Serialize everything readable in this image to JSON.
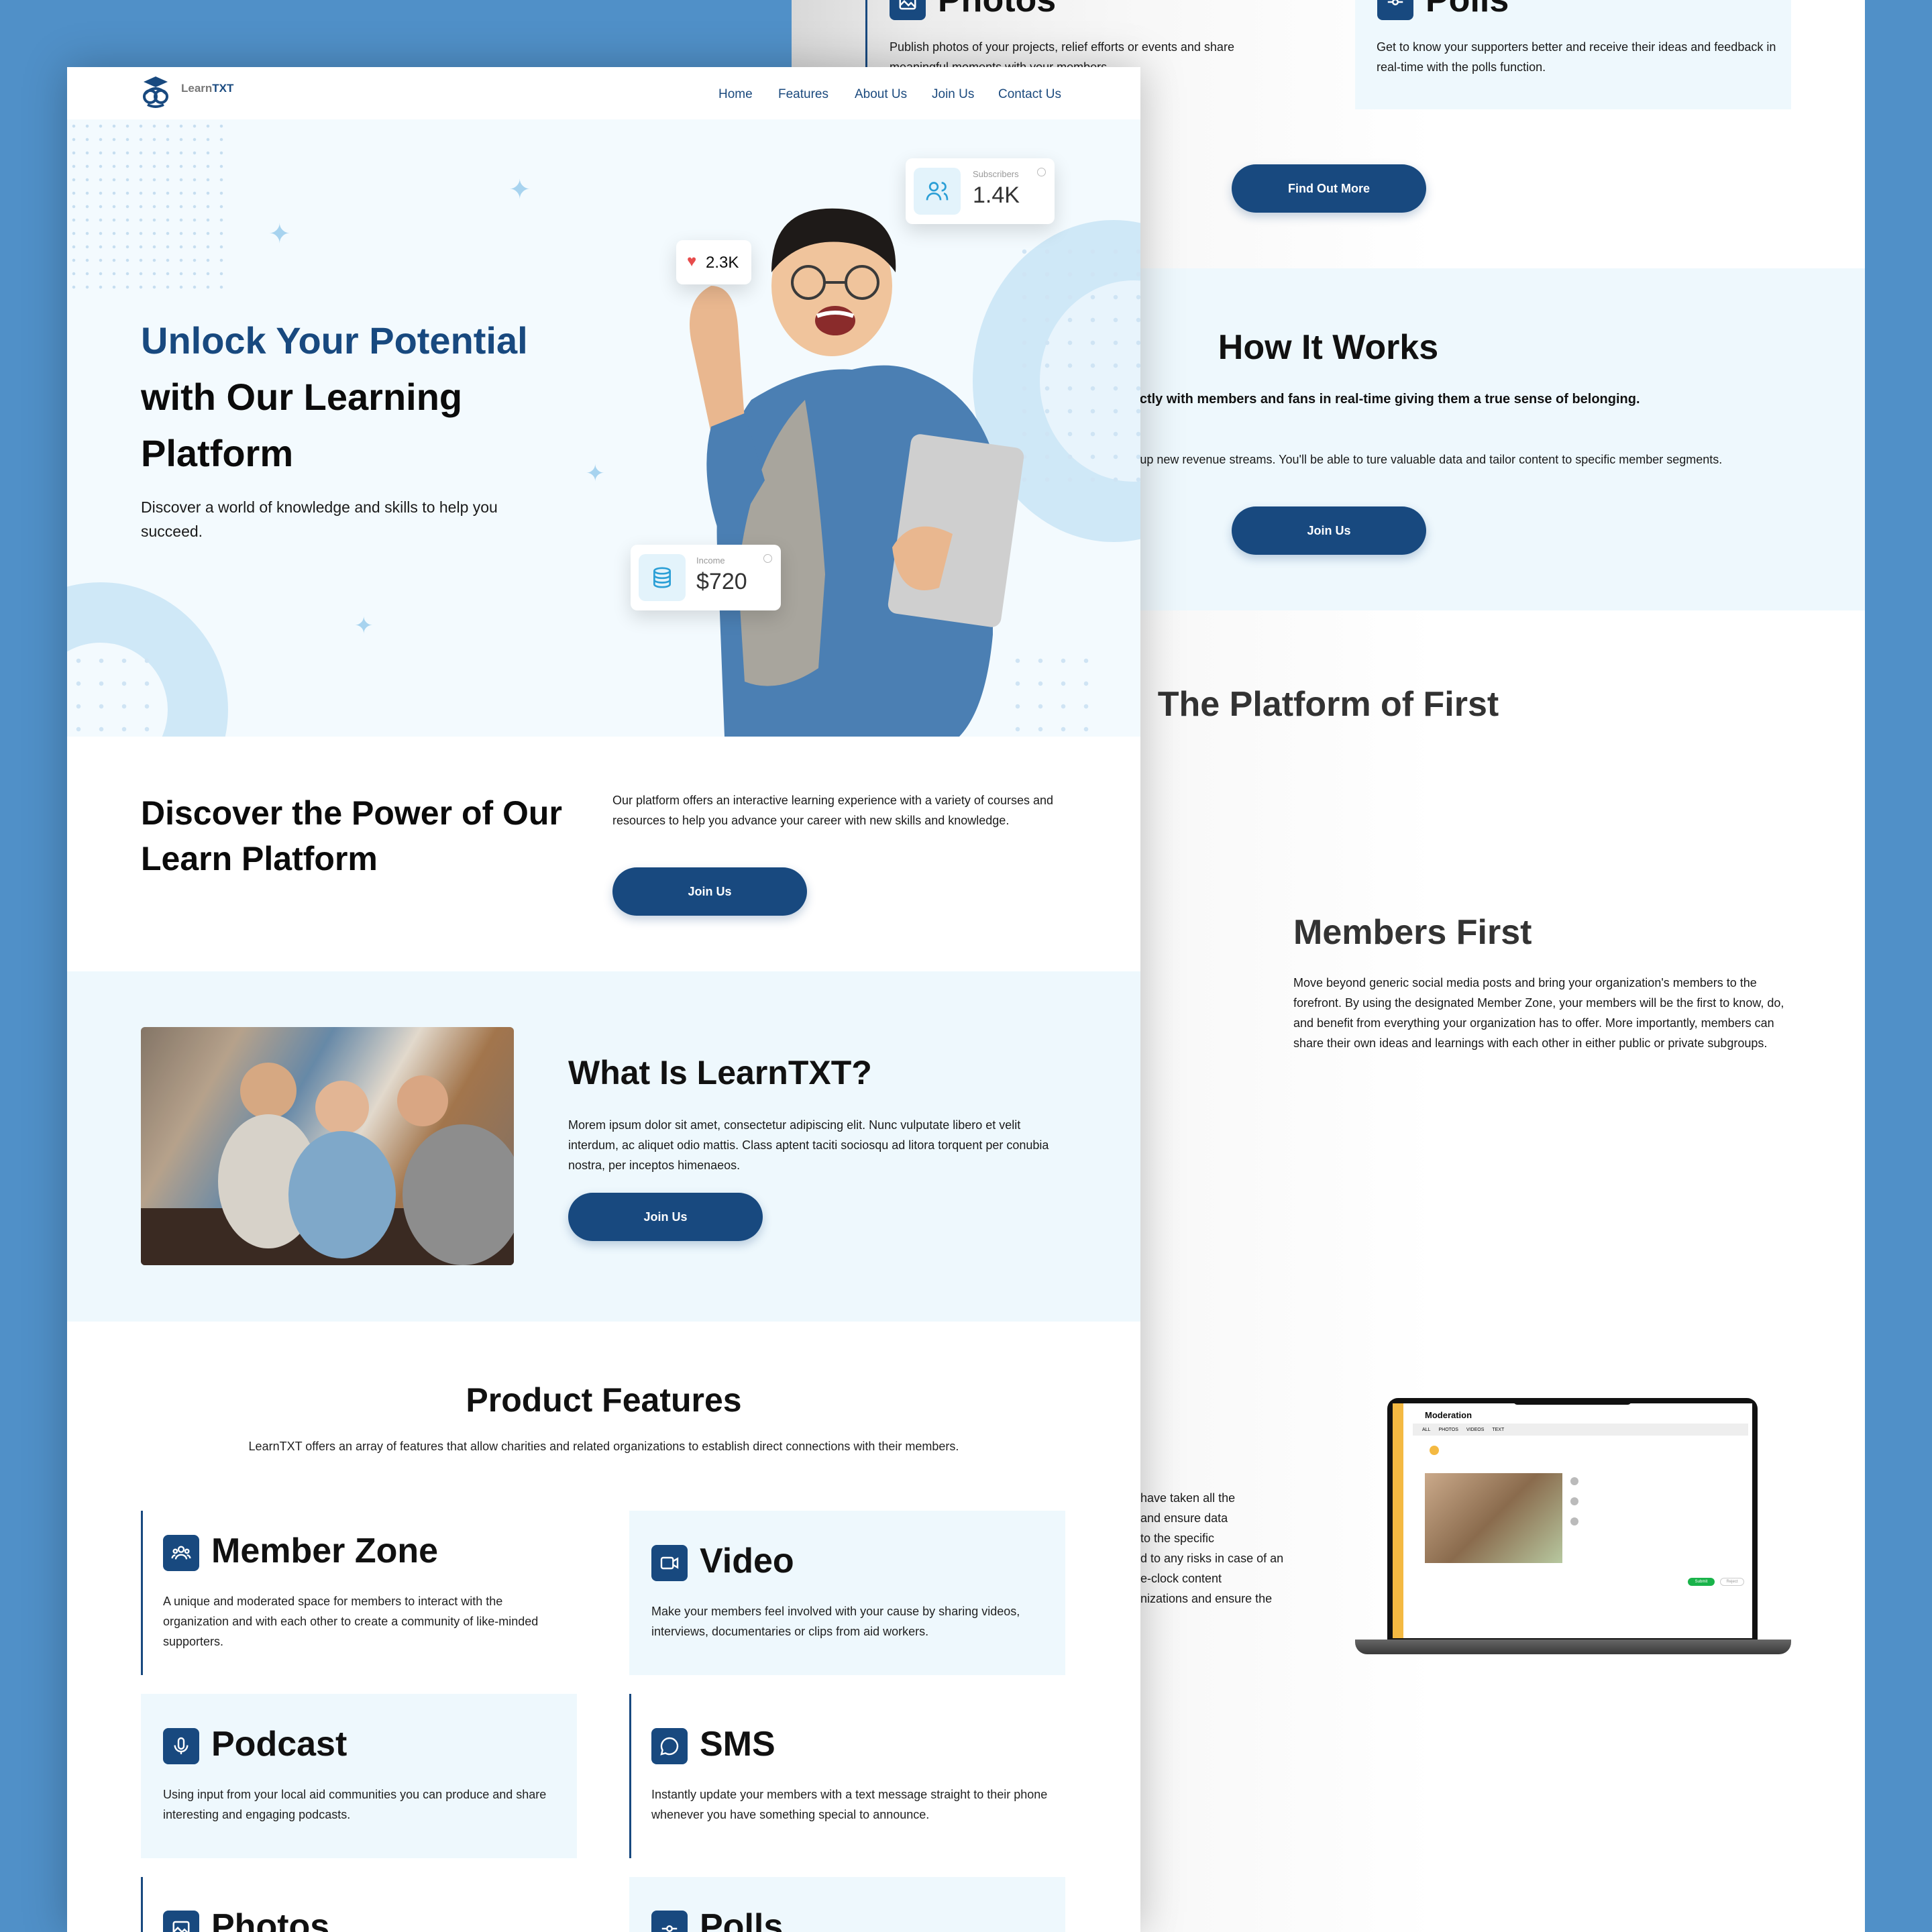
{
  "colors": {
    "primary": "#18497f",
    "accent_light": "#eef8fd",
    "hero_bg": "#f3fafe"
  },
  "brand": {
    "name_part1": "Learn",
    "name_part2": "TXT",
    "logo_icon": "owl-graduate-icon"
  },
  "nav": {
    "items": [
      "Home",
      "Features",
      "About Us",
      "Join Us",
      "Contact Us"
    ]
  },
  "hero": {
    "title_line1": "Unlock Your Potential",
    "title_line2": "with Our Learning",
    "title_line3": "Platform",
    "subtitle": "Discover a world of knowledge and skills to help you succeed.",
    "stat_likes": "2.3K",
    "stat_subscribers_label": "Subscribers",
    "stat_subscribers_value": "1.4K",
    "stat_income_label": "Income",
    "stat_income_value": "$720"
  },
  "discover": {
    "title": "Discover the Power of Our Learn Platform",
    "text": "Our platform offers an interactive learning experience with a variety of courses and resources to help you advance your career with new skills and knowledge.",
    "button": "Join Us"
  },
  "what_is": {
    "title": "What Is LearnTXT?",
    "text": "Morem ipsum dolor sit amet, consectetur adipiscing elit. Nunc vulputate libero et velit interdum, ac aliquet odio mattis. Class aptent taciti sociosqu ad litora torquent per conubia nostra, per inceptos himenaeos.",
    "button": "Join Us"
  },
  "features": {
    "title": "Product Features",
    "subtitle": "LearnTXT offers an array of features that allow charities and related organizations to establish direct connections with their members.",
    "items": [
      {
        "title": "Member Zone",
        "icon": "users-group-icon",
        "text": "A unique and moderated space for members to interact with the organization and with each other to create a community of like-minded supporters."
      },
      {
        "title": "Video",
        "icon": "video-camera-icon",
        "text": "Make your members feel involved with your cause by sharing videos, interviews, documentaries or clips from aid workers."
      },
      {
        "title": "Podcast",
        "icon": "microphone-icon",
        "text": "Using input from your local aid communities you can produce and share interesting and engaging podcasts."
      },
      {
        "title": "SMS",
        "icon": "chat-bubble-icon",
        "text": "Instantly update your members with a text message straight to their phone whenever you have something special to announce."
      },
      {
        "title": "Photos",
        "icon": "image-icon"
      },
      {
        "title": "Polls",
        "icon": "poll-slider-icon"
      }
    ]
  },
  "back_page": {
    "photos_title": "Photos",
    "photos_text": "Publish photos of your projects, relief efforts or events and share meaningful moments with your members.",
    "polls_title": "Polls",
    "polls_text": "Get to know your supporters better and receive their ideas and feedback in real-time with the polls function.",
    "find_out_button": "Find Out More",
    "how_title": "How It Works",
    "how_bold": "nunity platform that connects directly with members and fans in real-time giving them a true sense of belonging.",
    "how_text": "que opportunity to create more personalized experiences and open up new revenue streams. You'll be able to ture valuable data and tailor content to specific member segments.",
    "how_button": "Join Us",
    "platform_title": "The Platform of First",
    "members_title": "Members First",
    "members_text": "Move beyond generic social media posts and bring your organization's members to the forefront. By using the designated Member Zone, your members will be the first to know, do, and benefit from everything your organization has to offer. More importantly, members can share their own ideas and learnings with each other in either public or private subgroups.",
    "safety_lines": [
      "have taken all the",
      "and ensure data",
      "to the specific",
      "d to any risks in case of an",
      "e-clock content",
      "nizations and ensure the"
    ],
    "laptop": {
      "screen_title": "Moderation",
      "tabs": [
        "ALL",
        "PHOTOS",
        "VIDEOS",
        "TEXT"
      ],
      "submit": "Submit",
      "reject": "Reject"
    }
  }
}
